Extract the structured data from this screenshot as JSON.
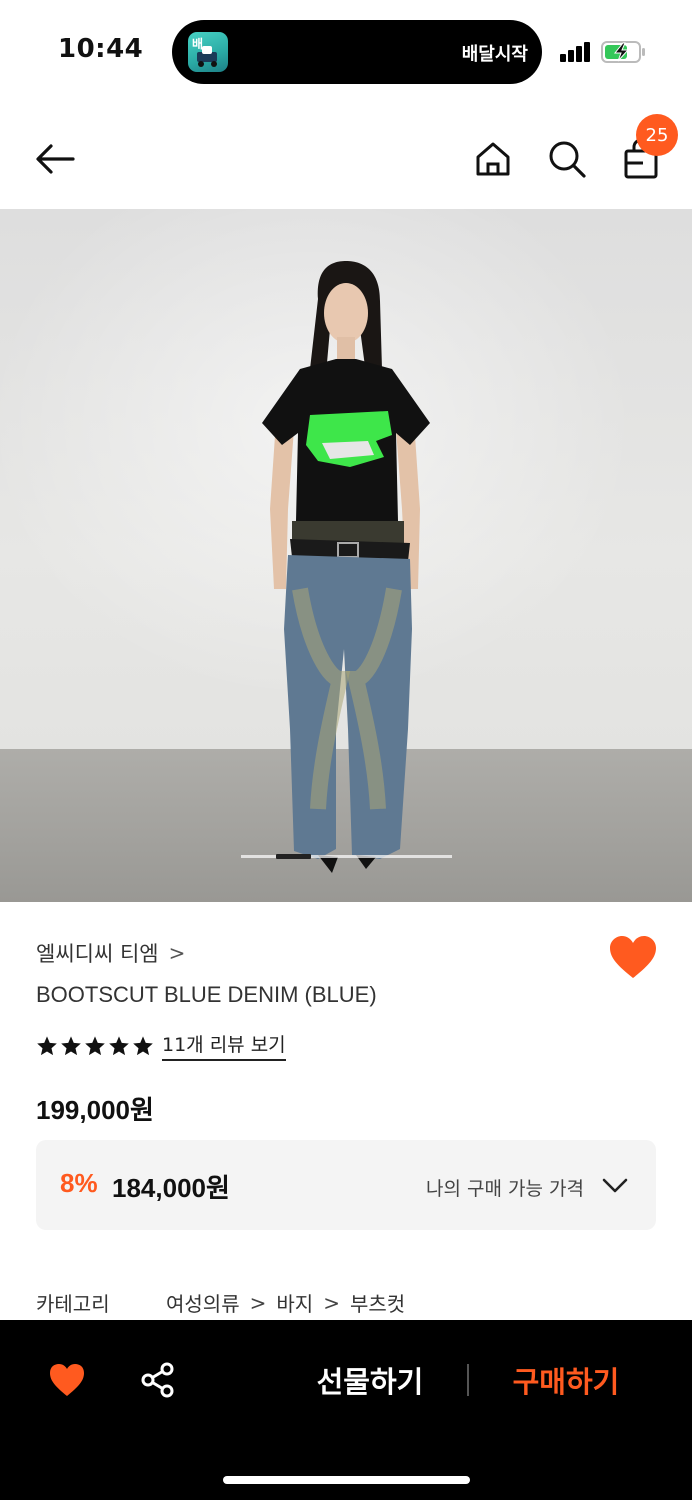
{
  "status_bar": {
    "time": "10:44",
    "live_activity_text": "배달시작",
    "app_icon_glyph": "배",
    "battery_state": "charging"
  },
  "nav": {
    "back_icon": "arrow-left-icon",
    "home_icon": "home-icon",
    "search_icon": "search-icon",
    "cart_icon": "shopping-bag-icon",
    "cart_count": "25"
  },
  "gallery": {
    "active_index_fraction": 0.17
  },
  "product": {
    "brand": "엘씨디씨 티엠",
    "brand_chevron": ">",
    "name": "BOOTSCUT BLUE DENIM (BLUE)",
    "rating_stars": 5,
    "review_link": "11개 리뷰 보기",
    "price": "199,000원",
    "discount_rate": "8%",
    "discount_price": "184,000원",
    "my_price_label": "나의 구매 가능 가격",
    "wishlisted": true
  },
  "category": {
    "label": "카테고리",
    "path": [
      "여성의류",
      "바지",
      "부츠컷"
    ],
    "separator": ">"
  },
  "bottom_bar": {
    "gift_label": "선물하기",
    "buy_label": "구매하기"
  },
  "colors": {
    "accent": "#ff5a1f",
    "bottom_bar_bg": "#000000",
    "discount_box_bg": "#f4f4f4"
  }
}
